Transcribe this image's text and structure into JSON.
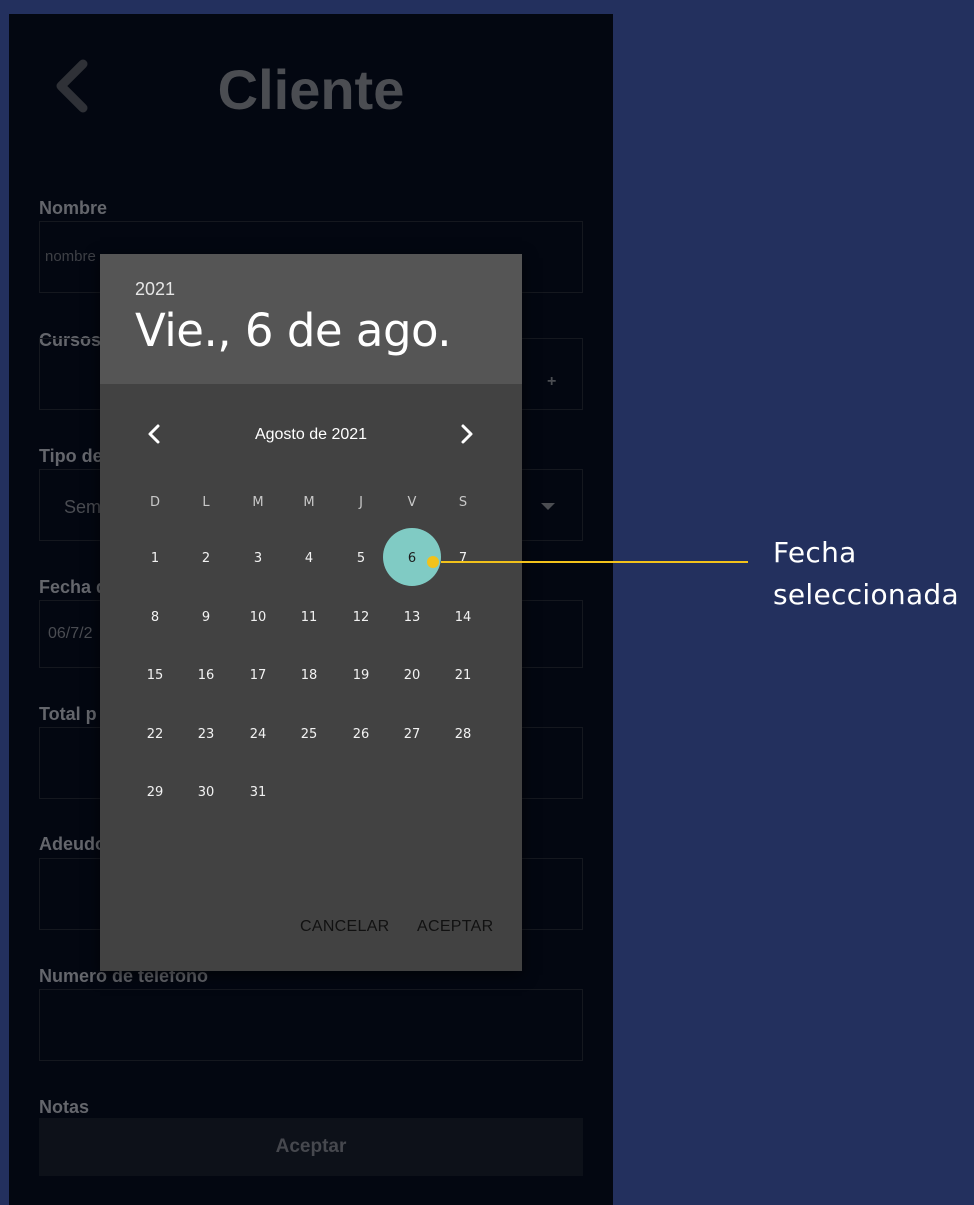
{
  "screen": {
    "title": "Cliente",
    "fields": {
      "nombre_label": "Nombre",
      "nombre_placeholder": "nombre",
      "cursos_label": "Cursos",
      "tipo_label": "Tipo de",
      "tipo_value": "Sem",
      "fecha_label": "Fecha d",
      "fecha_value": "06/7/2",
      "total_label": "Total p",
      "adeudo_label": "Adeudo",
      "telefono_label": "Numero de telefono",
      "notas_label": "Notas"
    },
    "plus_symbol": "+",
    "accept_button": "Aceptar"
  },
  "date_picker": {
    "year": "2021",
    "selected_date": "Vie., 6 de ago.",
    "month_label": "Agosto de 2021",
    "weekdays": [
      "D",
      "L",
      "M",
      "M",
      "J",
      "V",
      "S"
    ],
    "days": [
      "1",
      "2",
      "3",
      "4",
      "5",
      "6",
      "7",
      "8",
      "9",
      "10",
      "11",
      "12",
      "13",
      "14",
      "15",
      "16",
      "17",
      "18",
      "19",
      "20",
      "21",
      "22",
      "23",
      "24",
      "25",
      "26",
      "27",
      "28",
      "29",
      "30",
      "31"
    ],
    "selected_day": "6",
    "selected_color": "#80cbc4",
    "cancel_label": "CANCELAR",
    "ok_label": "ACEPTAR"
  },
  "annotation": {
    "line1": "Fecha",
    "line2": "seleccionada",
    "color": "#f2c21b"
  },
  "icons": {
    "back": "chevron-left-icon",
    "prev_month": "chevron-left-icon",
    "next_month": "chevron-right-icon",
    "dropdown": "caret-down-icon"
  }
}
